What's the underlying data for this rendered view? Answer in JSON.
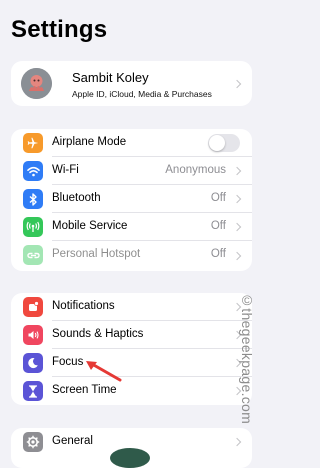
{
  "page": {
    "title": "Settings"
  },
  "profile": {
    "name": "Sambit Koley",
    "subtitle": "Apple ID, iCloud, Media & Purchases"
  },
  "connectivity": [
    {
      "label": "Airplane Mode",
      "icon": "airplane-icon",
      "color": "#f79a2b",
      "toggle": false
    },
    {
      "label": "Wi-Fi",
      "icon": "wifi-icon",
      "color": "#2f7cf6",
      "value": "Anonymous"
    },
    {
      "label": "Bluetooth",
      "icon": "bluetooth-icon",
      "color": "#2f7cf6",
      "value": "Off"
    },
    {
      "label": "Mobile Service",
      "icon": "antenna-icon",
      "color": "#34c759",
      "value": "Off"
    },
    {
      "label": "Personal Hotspot",
      "icon": "hotspot-icon",
      "color": "#34c759",
      "value": "Off"
    }
  ],
  "notifications_group": [
    {
      "label": "Notifications",
      "icon": "bell-icon",
      "color": "#f0483e"
    },
    {
      "label": "Sounds & Haptics",
      "icon": "speaker-icon",
      "color": "#f0465f"
    },
    {
      "label": "Focus",
      "icon": "moon-icon",
      "color": "#5b54d6"
    },
    {
      "label": "Screen Time",
      "icon": "hourglass-icon",
      "color": "#5b54d6"
    }
  ],
  "general_group": [
    {
      "label": "General",
      "icon": "gear-icon",
      "color": "#8e8e93"
    }
  ],
  "watermark": "©thegeekpage.com"
}
